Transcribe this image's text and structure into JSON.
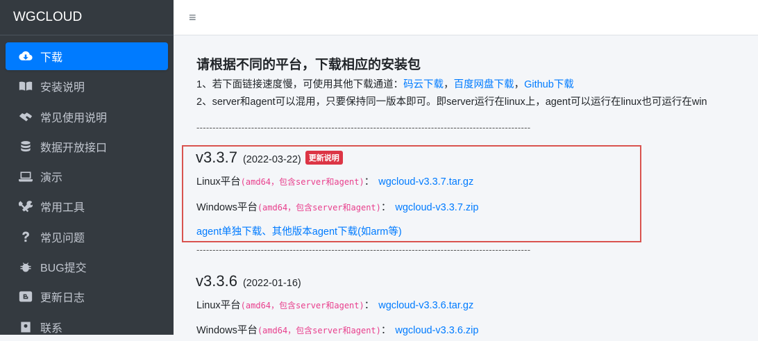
{
  "sidebar": {
    "brand": "WGCLOUD",
    "items": [
      {
        "label": "下载",
        "icon": "cloud-download-icon",
        "active": true
      },
      {
        "label": "安装说明",
        "icon": "book-icon",
        "active": false
      },
      {
        "label": "常见使用说明",
        "icon": "handshake-icon",
        "active": false
      },
      {
        "label": "数据开放接口",
        "icon": "database-icon",
        "active": false
      },
      {
        "label": "演示",
        "icon": "laptop-icon",
        "active": false
      },
      {
        "label": "常用工具",
        "icon": "tools-icon",
        "active": false
      },
      {
        "label": "常见问题",
        "icon": "question-icon",
        "active": false
      },
      {
        "label": "BUG提交",
        "icon": "bug-icon",
        "active": false
      },
      {
        "label": "更新日志",
        "icon": "blogger-icon",
        "active": false
      },
      {
        "label": "联系",
        "icon": "contact-icon",
        "active": false
      }
    ]
  },
  "topbar": {
    "menu_glyph": "≡"
  },
  "main": {
    "heading": "请根据不同的平台，下载相应的安装包",
    "line1_prefix": "1、若下面链接速度慢，可使用其他下载通道：",
    "line1_links": [
      "码云下载",
      "百度网盘下载",
      "Github下载"
    ],
    "line1_sep": "，",
    "line2": "2、server和agent可以混用，只要保持同一版本即可。即server运行在linux上，agent可以运行在linux也可运行在win",
    "separator": "--------------------------------------------------------------------------------------------------------",
    "releases": [
      {
        "version": "v3.3.7",
        "date": "(2022-03-22)",
        "badge": "更新说明",
        "linux_label": "Linux平台",
        "linux_note": "(amd64，包含server和agent)",
        "linux_colon": "：",
        "linux_file": "wgcloud-v3.3.7.tar.gz",
        "windows_label": "Windows平台",
        "windows_note": "(amd64，包含server和agent)",
        "windows_colon": "：",
        "windows_file": "wgcloud-v3.3.7.zip",
        "agent_link": "agent单独下载、其他版本agent下载(如arm等)"
      },
      {
        "version": "v3.3.6",
        "date": "(2022-01-16)",
        "linux_label": "Linux平台",
        "linux_note": "(amd64，包含server和agent)",
        "linux_colon": "：",
        "linux_file": "wgcloud-v3.3.6.tar.gz",
        "windows_label": "Windows平台",
        "windows_note": "(amd64，包含server和agent)",
        "windows_colon": "：",
        "windows_file": "wgcloud-v3.3.6.zip"
      }
    ]
  },
  "colors": {
    "sidebar_bg": "#343a40",
    "active": "#007bff",
    "link": "#007bff",
    "highlight_border": "#d9534f",
    "badge": "#dc3545",
    "code": "#e83e8c"
  }
}
